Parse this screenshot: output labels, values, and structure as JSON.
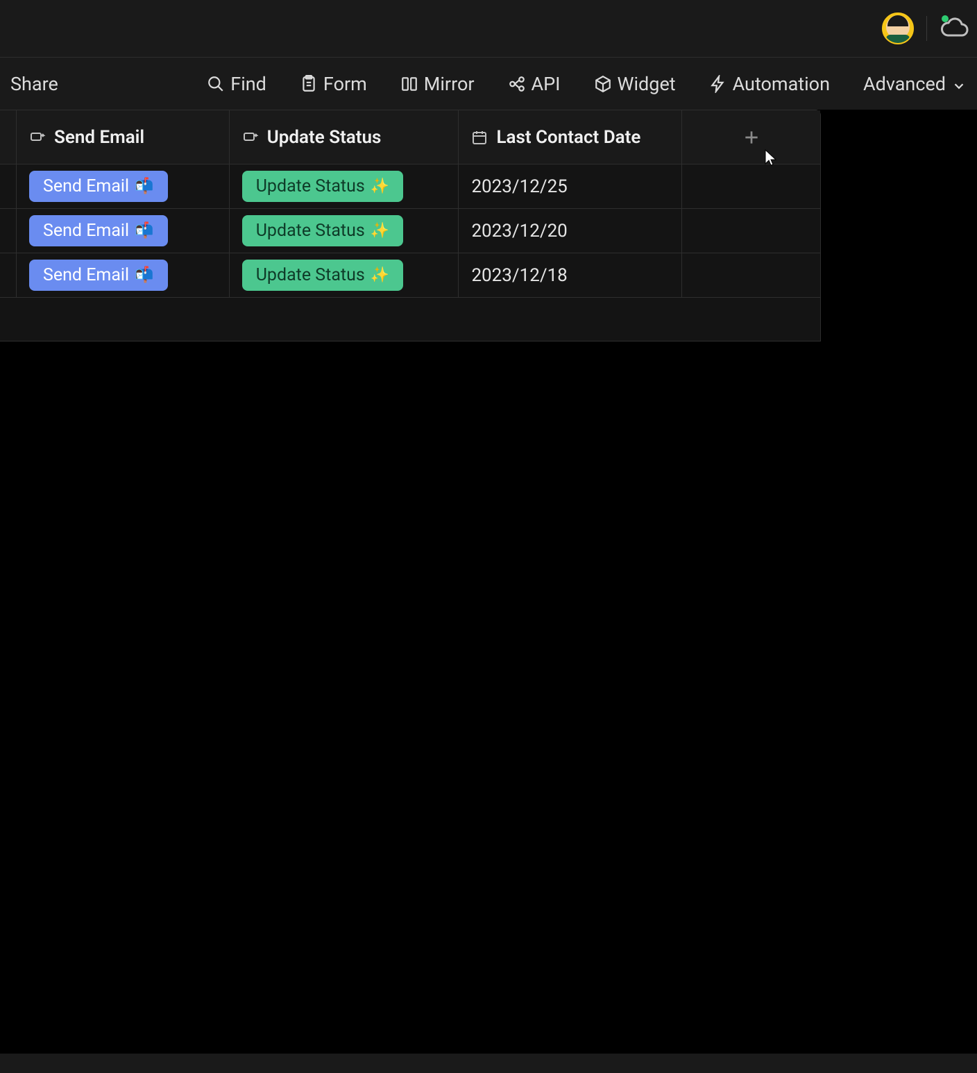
{
  "header": {
    "avatar_name": "user-avatar",
    "cloud_label": "sync-status"
  },
  "toolbar": {
    "share_label": "Share",
    "find_label": "Find",
    "form_label": "Form",
    "mirror_label": "Mirror",
    "api_label": "API",
    "widget_label": "Widget",
    "automation_label": "Automation",
    "advanced_label": "Advanced"
  },
  "grid": {
    "columns": [
      {
        "label": "Send Email",
        "icon": "button-col"
      },
      {
        "label": "Update Status",
        "icon": "button-col"
      },
      {
        "label": "Last Contact Date",
        "icon": "date-col"
      }
    ],
    "rows": [
      {
        "send_email": "Send Email",
        "send_email_emoji": "📬",
        "update_status": "Update Status",
        "update_status_emoji": "✨",
        "last_contact": "2023/12/25"
      },
      {
        "send_email": "Send Email",
        "send_email_emoji": "📬",
        "update_status": "Update Status",
        "update_status_emoji": "✨",
        "last_contact": "2023/12/20"
      },
      {
        "send_email": "Send Email",
        "send_email_emoji": "📬",
        "update_status": "Update Status",
        "update_status_emoji": "✨",
        "last_contact": "2023/12/18"
      }
    ]
  }
}
